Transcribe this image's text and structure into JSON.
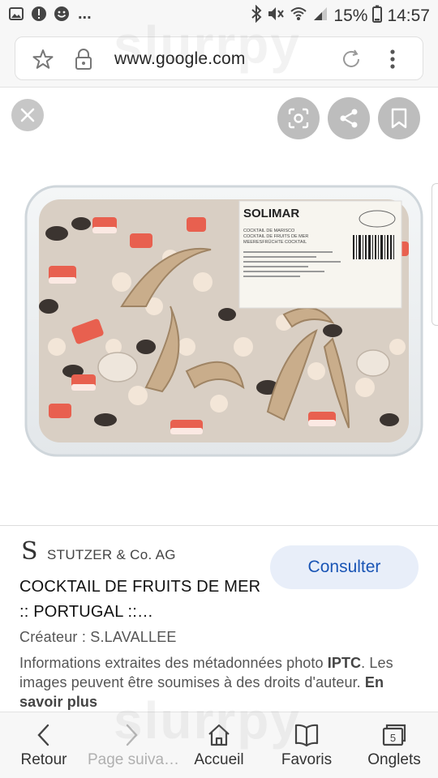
{
  "status_bar": {
    "more_indicator": "...",
    "battery": "15%",
    "time": "14:57"
  },
  "browser": {
    "url": "www.google.com"
  },
  "image": {
    "label_brand": "SOLIMAR",
    "label_line_1": "COCKTAIL DE MARISCO",
    "label_line_2": "COCKTAIL DE FRUITS DE MER",
    "label_line_3": "MEERESFRÜCHTE COCKTAIL"
  },
  "watermark": "slurrpy",
  "result": {
    "source_logo": "S",
    "source_name": "STUTZER & Co. AG",
    "consult_label": "Consulter",
    "title": "COCKTAIL DE FRUITS DE MER :: PORTUGAL ::…",
    "creator": "Créateur : S.LAVALLEE",
    "notice_pre": "Informations extraites des métadonnées photo ",
    "notice_bold": "IPTC",
    "notice_post": ". Les images peuvent être soumises à des droits d'auteur. ",
    "learn_more": "En savoir plus"
  },
  "nav": {
    "back": "Retour",
    "forward": "Page suiva…",
    "home": "Accueil",
    "bookmarks": "Favoris",
    "tabs": "Onglets",
    "tab_count": "5"
  },
  "colors": {
    "accent_button_bg": "#e8eef9",
    "accent_button_text": "#1a55b5",
    "overlay_buttons": "#bdbdbd"
  }
}
